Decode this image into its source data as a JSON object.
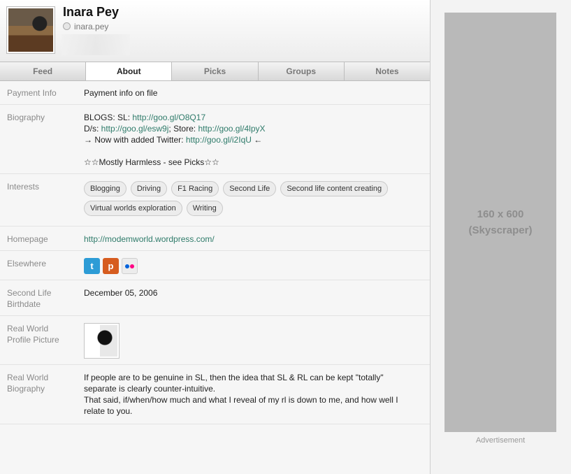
{
  "profile": {
    "name": "Inara Pey",
    "username": "inara.pey"
  },
  "tabs": [
    {
      "label": "Feed"
    },
    {
      "label": "About"
    },
    {
      "label": "Picks"
    },
    {
      "label": "Groups"
    },
    {
      "label": "Notes"
    }
  ],
  "about": {
    "payment": {
      "label": "Payment Info",
      "value": "Payment info on file"
    },
    "biography": {
      "label": "Biography",
      "line1_prefix": "BLOGS: SL: ",
      "line1_link": "http://goo.gl/O8Q17",
      "line2_prefix": "D/s: ",
      "line2_link1": "http://goo.gl/esw9j",
      "line2_mid": "; Store: ",
      "line2_link2": "http://goo.gl/4lpyX",
      "line3_prefix": "→ Now with added Twitter: ",
      "line3_link": "http://goo.gl/i2IqU",
      "line3_suffix": " ←",
      "line4": "☆☆Mostly Harmless - see Picks☆☆"
    },
    "interests": {
      "label": "Interests",
      "tags": [
        "Blogging",
        "Driving",
        "F1 Racing",
        "Second Life",
        "Second life content creating",
        "Virtual worlds exploration",
        "Writing"
      ]
    },
    "homepage": {
      "label": "Homepage",
      "value": "http://modemworld.wordpress.com/"
    },
    "elsewhere": {
      "label": "Elsewhere",
      "icons": [
        "twitter-icon",
        "plurk-icon",
        "flickr-icon"
      ]
    },
    "birthdate": {
      "label_line1": "Second Life",
      "label_line2": "Birthdate",
      "value": "December 05, 2006"
    },
    "rw_picture": {
      "label_line1": "Real World",
      "label_line2": "Profile Picture"
    },
    "rw_biography": {
      "label_line1": "Real World",
      "label_line2": "Biography",
      "line1": "If people are to be genuine in SL, then the idea that SL & RL can be kept \"totally\"",
      "line2": "separate is clearly counter-intuitive.",
      "line3": "That said, if/when/how much and what I reveal of my rl is down to me, and how well I",
      "line4": "relate to you."
    }
  },
  "ad": {
    "size_line": "160 x 600",
    "type_line": "(Skyscraper)",
    "label": "Advertisement"
  },
  "colors": {
    "link": "#2f7b6a",
    "twitter": "#2d9cd6",
    "plurk": "#d65c1f"
  }
}
